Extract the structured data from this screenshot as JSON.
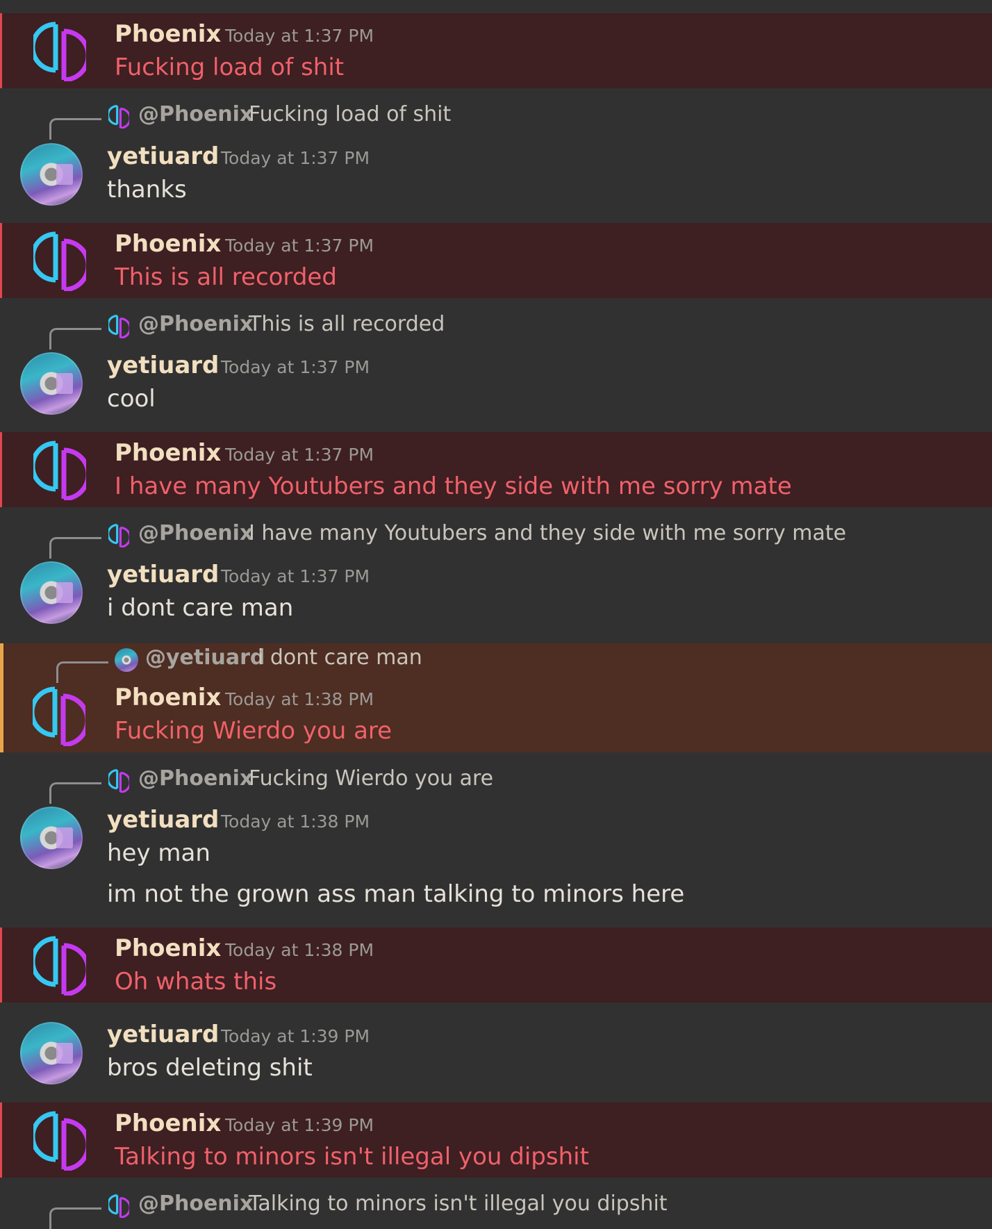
{
  "theme": {
    "background": "#313131",
    "blocked_highlight": "#3e1f22",
    "mention_highlight": "#4e2d22",
    "blocked_text_color": "#f0616a",
    "author_color": "#f2dfc0"
  },
  "messages": [
    {
      "author": "Phoenix",
      "time": "Today at 1:37 PM",
      "lines": [
        "Fucking load of shit"
      ]
    },
    {
      "reply_to": {
        "author": "@Phoenix",
        "text": "Fucking load of shit"
      },
      "author": "yetiuard",
      "time": "Today at 1:37 PM",
      "lines": [
        "thanks"
      ]
    },
    {
      "author": "Phoenix",
      "time": "Today at 1:37 PM",
      "lines": [
        "This is all recorded"
      ]
    },
    {
      "reply_to": {
        "author": "@Phoenix",
        "text": "This is all recorded"
      },
      "author": "yetiuard",
      "time": "Today at 1:37 PM",
      "lines": [
        "cool"
      ]
    },
    {
      "author": "Phoenix",
      "time": "Today at 1:37 PM",
      "lines": [
        "I have many Youtubers and they side with me sorry mate"
      ]
    },
    {
      "reply_to": {
        "author": "@Phoenix",
        "text": "I have many Youtubers and they side with me sorry mate"
      },
      "author": "yetiuard",
      "time": "Today at 1:37 PM",
      "lines": [
        "i dont care man"
      ]
    },
    {
      "reply_to": {
        "author": "@yetiuard",
        "text": "i dont care man"
      },
      "author": "Phoenix",
      "time": "Today at 1:38 PM",
      "lines": [
        "Fucking Wierdo you are"
      ]
    },
    {
      "reply_to": {
        "author": "@Phoenix",
        "text": "Fucking Wierdo you are"
      },
      "author": "yetiuard",
      "time": "Today at 1:38 PM",
      "lines": [
        "hey man",
        "im not the grown ass man talking to minors here"
      ]
    },
    {
      "author": "Phoenix",
      "time": "Today at 1:38 PM",
      "lines": [
        "Oh whats this"
      ]
    },
    {
      "author": "yetiuard",
      "time": "Today at 1:39 PM",
      "lines": [
        "bros deleting shit"
      ]
    },
    {
      "author": "Phoenix",
      "time": "Today at 1:39 PM",
      "lines": [
        "Talking to minors isn't illegal you dipshit"
      ]
    },
    {
      "reply_to": {
        "author": "@Phoenix",
        "text": "Talking to minors isn't illegal you dipshit"
      }
    }
  ]
}
